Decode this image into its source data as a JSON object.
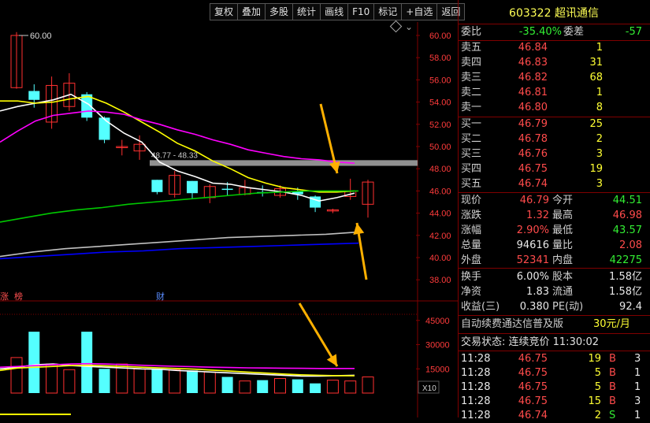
{
  "toolbar": {
    "buttons": [
      "复权",
      "叠加",
      "多股",
      "统计",
      "画线",
      "F10",
      "标记",
      "+自选",
      "返回"
    ]
  },
  "chart": {
    "price_axis": [
      "60.00",
      "58.00",
      "56.00",
      "54.00",
      "52.00",
      "50.00",
      "48.00",
      "46.00",
      "44.00",
      "42.00",
      "40.00",
      "38.00"
    ],
    "high_label": "60.00",
    "range_label": "48.77 - 48.33",
    "event_labels": [
      "涨",
      "榜",
      "财"
    ],
    "volume_axis": [
      "45000",
      "30000",
      "15000"
    ],
    "volume_unit": "X10",
    "colors": {
      "up": "#ff3030",
      "down": "#54ffff",
      "ma5": "#ffffff",
      "ma10": "#ffff00",
      "ma20": "#ff00ff",
      "ma60": "#00c800",
      "ma120": "#c0c0c0",
      "ma250": "#0000ff",
      "arrow": "#ffb000"
    }
  },
  "quote": {
    "title": "603322 超讯通信",
    "weibi_label": "委比",
    "weibi": "-35.40%",
    "weicha_label": "委差",
    "weicha": "-57",
    "sell": [
      {
        "label": "卖五",
        "price": "46.84",
        "vol": "1"
      },
      {
        "label": "卖四",
        "price": "46.83",
        "vol": "31"
      },
      {
        "label": "卖三",
        "price": "46.82",
        "vol": "68"
      },
      {
        "label": "卖二",
        "price": "46.81",
        "vol": "1"
      },
      {
        "label": "卖一",
        "price": "46.80",
        "vol": "8"
      }
    ],
    "buy": [
      {
        "label": "买一",
        "price": "46.79",
        "vol": "25"
      },
      {
        "label": "买二",
        "price": "46.78",
        "vol": "2"
      },
      {
        "label": "买三",
        "price": "46.76",
        "vol": "3"
      },
      {
        "label": "买四",
        "price": "46.75",
        "vol": "19"
      },
      {
        "label": "买五",
        "price": "46.74",
        "vol": "3"
      }
    ],
    "stats": [
      {
        "l1": "现价",
        "v1": "46.79",
        "c1": "red",
        "l2": "今开",
        "v2": "44.51",
        "c2": "green"
      },
      {
        "l1": "涨跌",
        "v1": "1.32",
        "c1": "red",
        "l2": "最高",
        "v2": "46.98",
        "c2": "red"
      },
      {
        "l1": "涨幅",
        "v1": "2.90%",
        "c1": "red",
        "l2": "最低",
        "v2": "43.57",
        "c2": "green"
      },
      {
        "l1": "总量",
        "v1": "94616",
        "c1": "white",
        "l2": "量比",
        "v2": "2.08",
        "c2": "red"
      },
      {
        "l1": "外盘",
        "v1": "52341",
        "c1": "red",
        "l2": "内盘",
        "v2": "42275",
        "c2": "green"
      }
    ],
    "stats2": [
      {
        "l1": "换手",
        "v1": "6.00%",
        "l2": "股本",
        "v2": "1.58亿"
      },
      {
        "l1": "净资",
        "v1": "1.83",
        "l2": "流通",
        "v2": "1.58亿"
      },
      {
        "l1": "收益(三)",
        "v1": "0.380",
        "l2": "PE(动)",
        "v2": "92.4"
      }
    ],
    "ad_text": "自动续费通达信普及版",
    "ad_price": "30元/月",
    "state": "交易状态: 连续竞价 11:30:02",
    "ticks": [
      {
        "time": "11:28",
        "price": "46.75",
        "vol": "19",
        "side": "B",
        "n": "3",
        "color": "red"
      },
      {
        "time": "11:28",
        "price": "46.75",
        "vol": "5",
        "side": "B",
        "n": "1",
        "color": "red"
      },
      {
        "time": "11:28",
        "price": "46.75",
        "vol": "5",
        "side": "B",
        "n": "1",
        "color": "red"
      },
      {
        "time": "11:28",
        "price": "46.75",
        "vol": "15",
        "side": "B",
        "n": "3",
        "color": "red"
      },
      {
        "time": "11:28",
        "price": "46.74",
        "vol": "2",
        "side": "S",
        "n": "1",
        "color": "green"
      }
    ]
  }
}
